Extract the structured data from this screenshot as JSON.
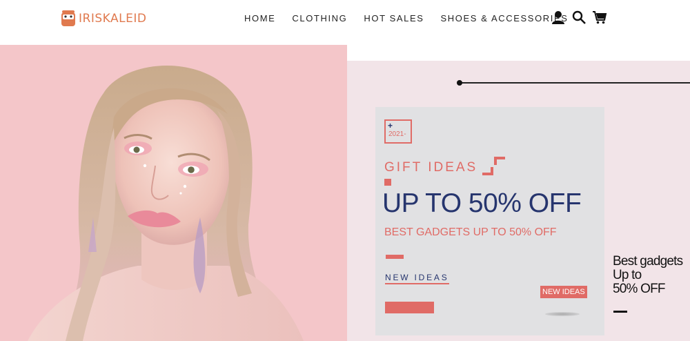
{
  "brand": {
    "name": "IRISKALEID",
    "color": "#e07a4f"
  },
  "nav": {
    "items": [
      {
        "label": "HOME"
      },
      {
        "label": "CLOTHING"
      },
      {
        "label": "HOT SALES"
      },
      {
        "label": "SHOES & ACCESSORIES"
      }
    ]
  },
  "header_icons": [
    "account-icon",
    "search-icon",
    "cart-icon"
  ],
  "hero": {
    "year": "2021-",
    "gift_title": "GIFT IDEAS",
    "headline": "UP TO 50% OFF",
    "subline": "BEST GADGETS UP TO 50% OFF",
    "link_label": "NEW IDEAS",
    "badge_label": "NEW IDEAS",
    "side_lines": [
      "Best gadgets",
      "Up to",
      "50% OFF"
    ]
  },
  "colors": {
    "accent": "#e06b66",
    "navy": "#26356e",
    "left_bg": "#f4c6c9",
    "right_bg": "#f2e4e8",
    "card_bg": "#e1e1e3"
  }
}
